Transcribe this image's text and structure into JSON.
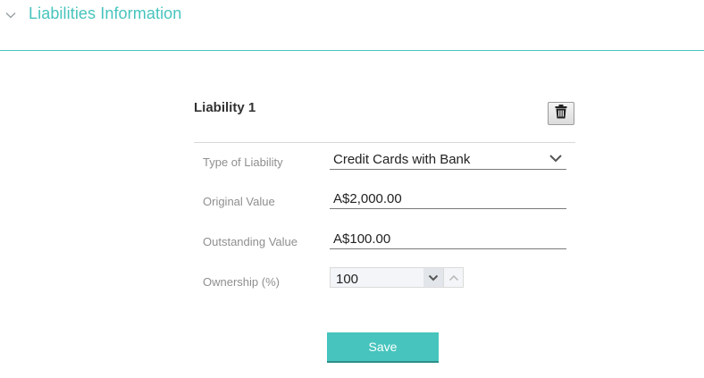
{
  "section": {
    "title": "Liabilities Information",
    "expanded": true
  },
  "liability": {
    "title": "Liability 1",
    "fields": {
      "type": {
        "label": "Type of Liability",
        "value": "Credit Cards with Bank"
      },
      "original_value": {
        "label": "Original Value",
        "value": "A$2,000.00"
      },
      "outstanding_value": {
        "label": "Outstanding Value",
        "value": "A$100.00"
      },
      "ownership": {
        "label": "Ownership (%)",
        "value": "100"
      }
    }
  },
  "actions": {
    "save_label": "Save"
  },
  "icons": {
    "collapse": "chevron-down-icon",
    "delete": "trash-icon"
  },
  "colors": {
    "accent": "#46c4bd",
    "label": "#8f8f8f"
  }
}
